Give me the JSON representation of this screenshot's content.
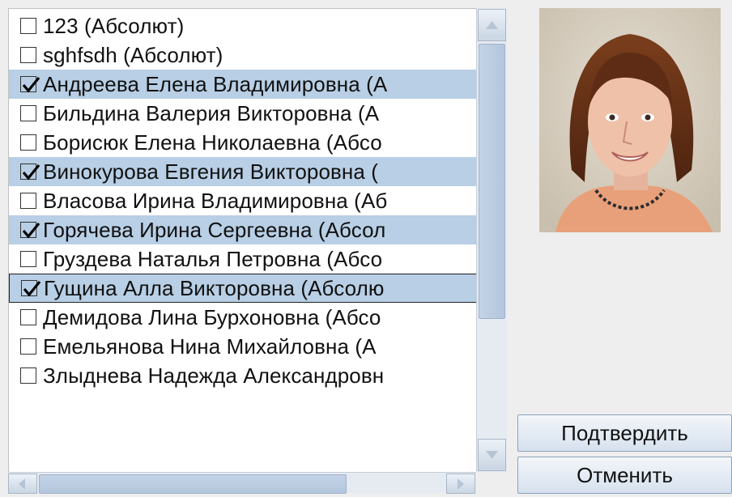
{
  "members": [
    {
      "label": "123 (Абсолют)",
      "checked": false
    },
    {
      "label": "sghfsdh (Абсолют)",
      "checked": false
    },
    {
      "label": "Андреева Елена Владимировна (А",
      "checked": true
    },
    {
      "label": "Бильдина Валерия Викторовна (А",
      "checked": false
    },
    {
      "label": "Борисюк Елена Николаевна (Абсо",
      "checked": false
    },
    {
      "label": "Винокурова Евгения Викторовна (",
      "checked": true
    },
    {
      "label": "Власова Ирина Владимировна (Аб",
      "checked": false
    },
    {
      "label": "Горячева Ирина Сергеевна (Абсол",
      "checked": true
    },
    {
      "label": "Груздева Наталья Петровна (Абсо",
      "checked": false
    },
    {
      "label": "Гущина Алла Викторовна (Абсолю",
      "checked": true,
      "focused": true
    },
    {
      "label": "Демидова Лина Бурхоновна (Абсо",
      "checked": false
    },
    {
      "label": "Емельянова  Нина Михайловна (А",
      "checked": false
    },
    {
      "label": "Злыднева Надежда Александровн",
      "checked": false
    }
  ],
  "buttons": {
    "confirm_label": "Подтвердить",
    "cancel_label": "Отменить"
  },
  "colors": {
    "selection": "#b8cfe5",
    "button_border": "#8ea2bb"
  },
  "photo_icon": "profile-photo"
}
